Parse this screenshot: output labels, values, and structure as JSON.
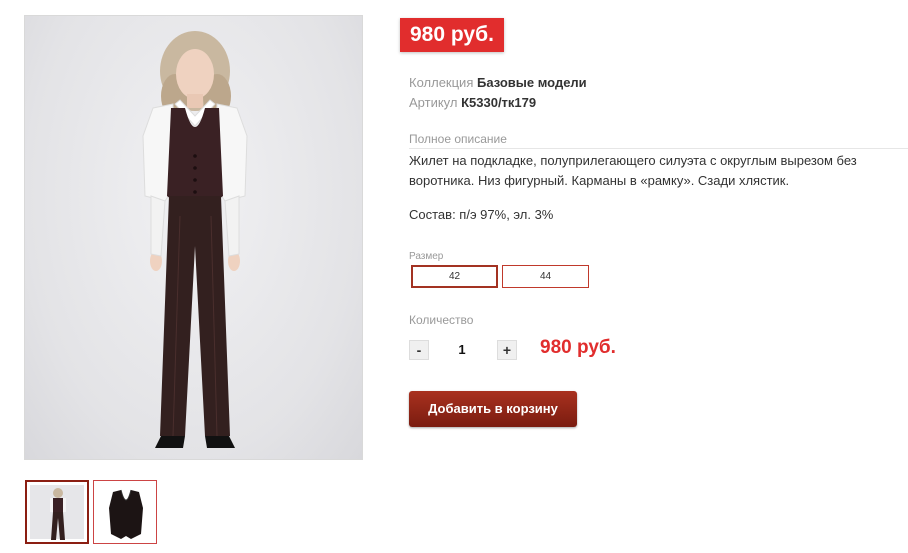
{
  "product": {
    "price_badge": "980 руб.",
    "collection_label": "Коллекция",
    "collection_value": "Базовые модели",
    "sku_label": "Артикул",
    "sku_value": "К5330/тк179",
    "description_title": "Полное описание",
    "description": "Жилет на подкладке, полуприлегающего силуэта с округлым вырезом без воротника. Низ фигурный. Карманы в «рамку». Сзади хлястик.",
    "composition": "Состав: п/э 97%, эл. 3%"
  },
  "size": {
    "label": "Размер",
    "options": [
      "42",
      "44"
    ],
    "selected": "42"
  },
  "quantity": {
    "label": "Количество",
    "minus": "-",
    "plus": "+",
    "value": "1",
    "total": "980 руб."
  },
  "actions": {
    "add_to_cart": "Добавить в корзину"
  },
  "colors": {
    "accent_red": "#e12d2d",
    "button_dark_red": "#8b1e12"
  }
}
